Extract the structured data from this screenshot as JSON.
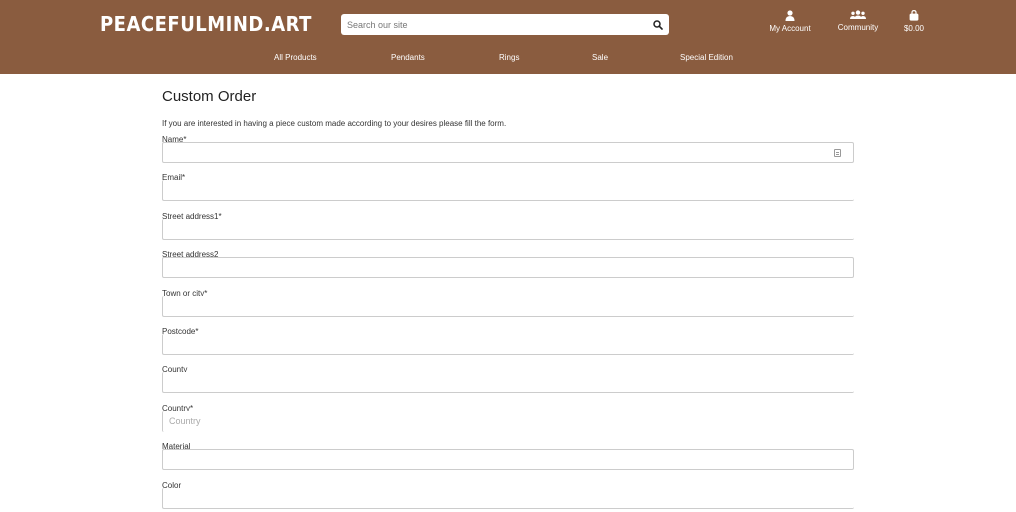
{
  "brand": {
    "logo": "PEACEFULMIND.ART"
  },
  "header": {
    "search_placeholder": "Search our site",
    "account_label": "My Account",
    "community_label": "Community",
    "bag_total": "$0.00"
  },
  "nav": {
    "items": [
      "All Products",
      "Pendants",
      "Rings",
      "Sale",
      "Special Edition"
    ]
  },
  "page": {
    "title": "Custom Order",
    "intro": "If you are interested in having a piece custom made according to your desires please fill the form."
  },
  "form": {
    "fields": [
      {
        "label": "Name*",
        "value": ""
      },
      {
        "label": "Email*",
        "value": ""
      },
      {
        "label": "Street address1*",
        "value": ""
      },
      {
        "label": "Street address2",
        "value": ""
      },
      {
        "label": "Town or city*",
        "value": ""
      },
      {
        "label": "Postcode*",
        "value": ""
      },
      {
        "label": "County",
        "value": ""
      },
      {
        "label": "Country*",
        "placeholder": "Country"
      },
      {
        "label": "Material",
        "value": ""
      },
      {
        "label": "Color",
        "value": ""
      }
    ]
  },
  "colors": {
    "header_bg": "#8a5c3f",
    "text": "#333333"
  }
}
